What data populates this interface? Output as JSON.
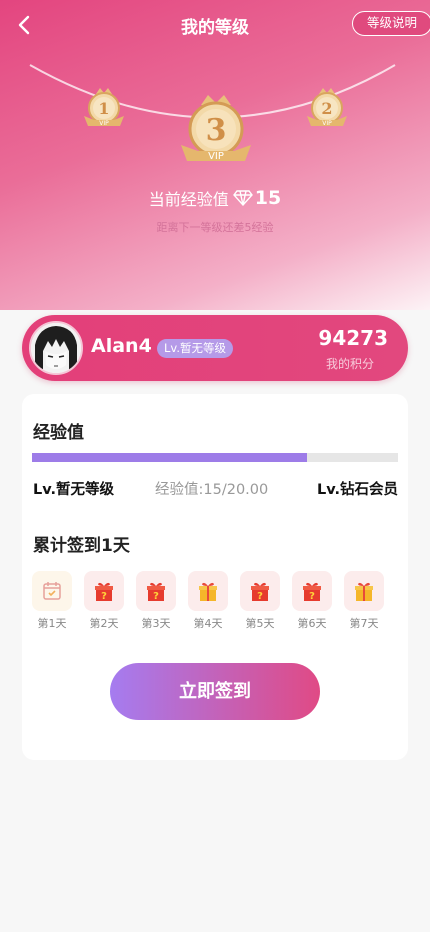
{
  "header": {
    "title": "我的等级",
    "help_label": "等级说明"
  },
  "badges": {
    "left": "1",
    "left_tag": "VIP",
    "center": "3",
    "center_tag": "VIP",
    "right": "2",
    "right_tag": "VIP"
  },
  "experience": {
    "label": "当前经验值",
    "value": "15",
    "next_hint": "距离下一等级还差5经验"
  },
  "user": {
    "name": "Alan4",
    "level_badge": "Lv.暂无等级",
    "points": "94273",
    "points_label": "我的积分"
  },
  "exp_section": {
    "title": "经验值",
    "progress": 0.75,
    "current_level": "Lv.暂无等级",
    "exp_text": "经验值:15/20.00",
    "next_level": "Lv.钻石会员"
  },
  "signin": {
    "title": "累计签到1天",
    "days": [
      {
        "label": "第1天",
        "icon": "calendar-check-icon"
      },
      {
        "label": "第2天",
        "icon": "mystery-gift-icon"
      },
      {
        "label": "第3天",
        "icon": "mystery-gift-icon"
      },
      {
        "label": "第4天",
        "icon": "gift-box-icon"
      },
      {
        "label": "第5天",
        "icon": "mystery-gift-icon"
      },
      {
        "label": "第6天",
        "icon": "mystery-gift-icon"
      },
      {
        "label": "第7天",
        "icon": "gift-box-icon"
      }
    ],
    "button_label": "立即签到"
  },
  "colors": {
    "brand_pink": "#e3457f",
    "accent_purple": "#9d7ce8",
    "gold": "#e5b76d"
  }
}
